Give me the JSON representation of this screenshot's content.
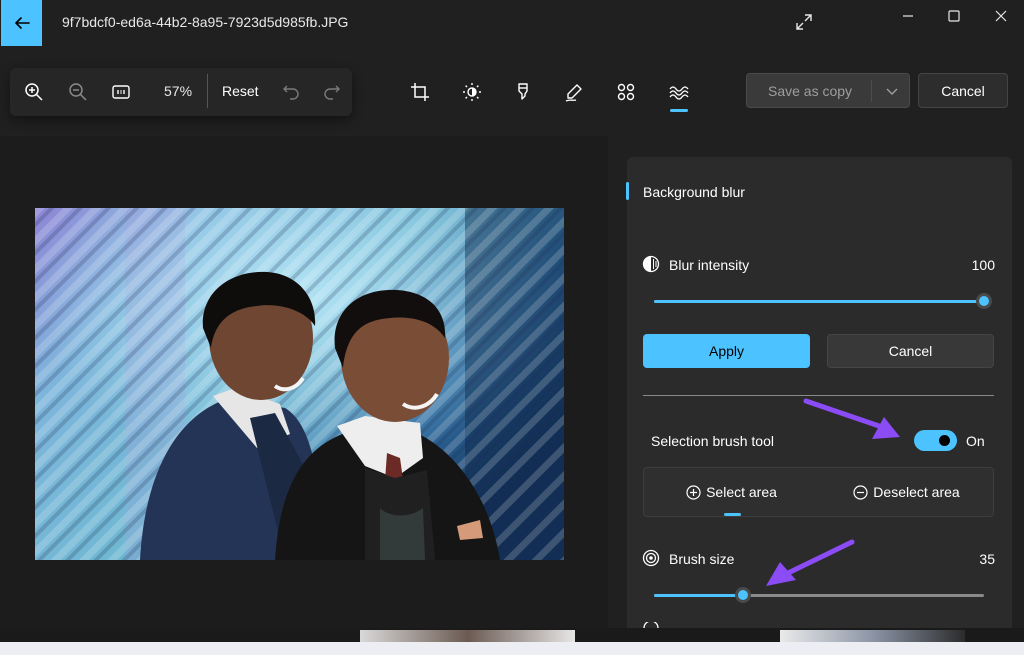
{
  "window": {
    "file_name": "9f7bdcf0-ed6a-44b2-8a95-7923d5d985fb.JPG"
  },
  "toolbar": {
    "zoom_level": "57%",
    "reset_label": "Reset",
    "save_label": "Save as copy",
    "cancel_label": "Cancel",
    "icons": [
      "zoom-in-icon",
      "zoom-out-icon",
      "actual-size-icon",
      "undo-icon",
      "redo-icon",
      "crop-icon",
      "adjustment-icon",
      "filter-icon",
      "markup-icon",
      "retouch-icon",
      "background-blur-icon"
    ]
  },
  "panel": {
    "section_title": "Background blur",
    "blur_intensity": {
      "label": "Blur intensity",
      "value": "100",
      "fraction": 1.0
    },
    "apply_label": "Apply",
    "cancel_label": "Cancel",
    "selection_brush": {
      "label": "Selection brush tool",
      "state": "On"
    },
    "select_area_label": "Select area",
    "deselect_area_label": "Deselect area",
    "brush_size": {
      "label": "Brush size",
      "value": "35",
      "fraction": 0.27
    }
  },
  "colors": {
    "accent": "#4cc2ff",
    "annotation_arrow": "#8b4bf5",
    "background": "#202020",
    "panel": "#2b2b2b"
  }
}
